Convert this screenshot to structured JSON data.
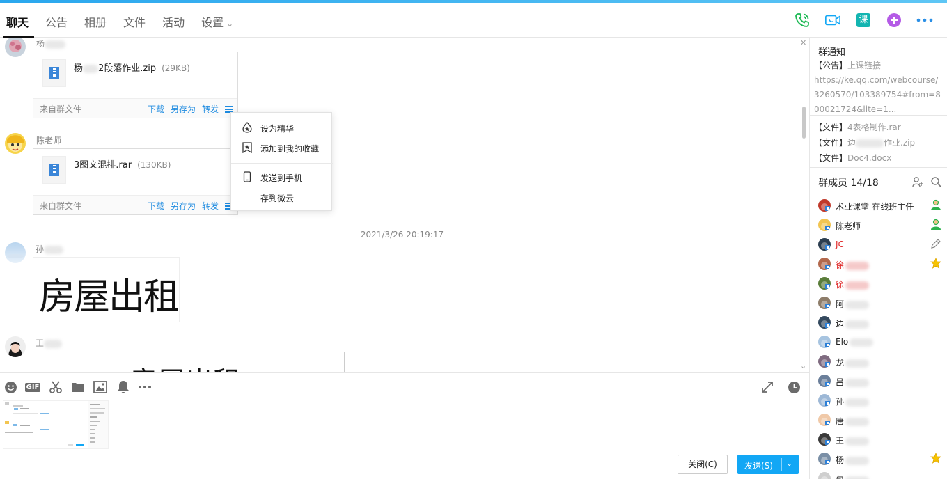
{
  "header": {
    "tabs": [
      "聊天",
      "公告",
      "相册",
      "文件",
      "活动",
      "设置"
    ],
    "active_tab": "聊天",
    "icons": [
      "phone-call-icon",
      "video-call-icon",
      "class-icon",
      "add-app-icon",
      "more-icon"
    ],
    "class_icon_text": "课"
  },
  "chat": {
    "messages": [
      {
        "sender": "杨",
        "file": {
          "name_prefix": "杨",
          "name_suffix": "2段落作业.zip",
          "size": "(29KB)"
        },
        "footer": {
          "from": "来自群文件",
          "actions": [
            "下载",
            "另存为",
            "转发"
          ]
        }
      },
      {
        "sender": "陈老师",
        "file": {
          "name": "3图文混排.rar",
          "size": "(130KB)"
        },
        "footer": {
          "from": "来自群文件",
          "actions": [
            "下载",
            "另存为",
            "转发"
          ]
        }
      }
    ],
    "timestamp": "2021/3/26 20:19:17",
    "image_messages": [
      {
        "sender": "孙",
        "image_text": "房屋出租"
      },
      {
        "sender": "王",
        "image_text": "房屋出租"
      }
    ]
  },
  "context_menu": {
    "items": [
      "设为精华",
      "添加到我的收藏",
      "发送到手机",
      "存到微云"
    ]
  },
  "toolbar": {
    "icons": [
      "emoji-icon",
      "gif-icon",
      "screenshot-scissors-icon",
      "folder-icon",
      "image-icon",
      "bell-icon",
      "more-icon"
    ],
    "gif_label": "GIF",
    "right_icons": [
      "expand-icon",
      "history-clock-icon"
    ]
  },
  "input": {
    "close_label": "关闭(C)",
    "send_label": "发送(S)"
  },
  "sidebar": {
    "notice_title": "群通知",
    "announcement_prefix": "【公告】",
    "announcement_text": "上课链接",
    "announcement_link": "https://ke.qq.com/webcourse/3260570/103389754#from=800021724&lite=1...",
    "files": [
      {
        "prefix": "【文件】",
        "name": "4表格制作.rar"
      },
      {
        "prefix": "【文件】",
        "name_prefix": "边",
        "name_suffix": "作业.zip"
      },
      {
        "prefix": "【文件】",
        "name": "Doc4.docx"
      }
    ],
    "members_title": "群成员 14/18",
    "members": [
      {
        "name": "术业课堂-在线班主任",
        "red": false,
        "badge": "admin"
      },
      {
        "name": "陈老师",
        "red": false,
        "badge": "admin"
      },
      {
        "name": "JC",
        "red": true,
        "badge": "edit"
      },
      {
        "name": "徐",
        "red": true,
        "badge": "star"
      },
      {
        "name": "徐",
        "red": true,
        "badge": ""
      },
      {
        "name": "阿",
        "red": false,
        "badge": ""
      },
      {
        "name": "边",
        "red": false,
        "badge": ""
      },
      {
        "name": "Elo",
        "red": false,
        "badge": ""
      },
      {
        "name": "龙",
        "red": false,
        "badge": ""
      },
      {
        "name": "吕",
        "red": false,
        "badge": ""
      },
      {
        "name": "孙",
        "red": false,
        "badge": ""
      },
      {
        "name": "唐",
        "red": false,
        "badge": ""
      },
      {
        "name": "王",
        "red": false,
        "badge": ""
      },
      {
        "name": "杨",
        "red": false,
        "badge": "star"
      },
      {
        "name": "包",
        "red": false,
        "badge": ""
      }
    ]
  },
  "colors": {
    "accent": "#12a7f5",
    "link": "#1e8be0",
    "red_name": "#e02a2a",
    "phone": "#1db954",
    "video": "#12a7f5",
    "class": "#13b5b1",
    "add": "#b45be6"
  }
}
